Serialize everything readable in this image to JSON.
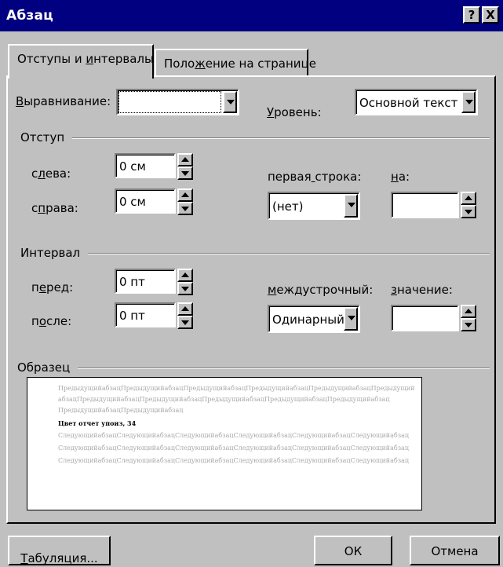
{
  "window": {
    "title": "Абзац",
    "help_button": "?",
    "close_button": "X"
  },
  "tabs": [
    {
      "label_pre": "Отступы и ",
      "label_u": "и",
      "label_post": "нтервалы",
      "active": true
    },
    {
      "label_pre": "Поло",
      "label_u": "ж",
      "label_post": "ение на странице",
      "active": false
    }
  ],
  "alignment": {
    "label_u": "В",
    "label_rest": "ыравнивание:",
    "value": ""
  },
  "level": {
    "label_u": "У",
    "label_rest": "ровень:",
    "value": "Основной текст"
  },
  "indent": {
    "group_title": "Отступ",
    "left": {
      "label_pre": "с",
      "label_u": "л",
      "label_post": "ева:",
      "value": "0 см"
    },
    "right": {
      "label_pre": "с",
      "label_u": "п",
      "label_post": "рава:",
      "value": "0 см"
    },
    "first_line": {
      "label_pre": "первая",
      "label_u": " ",
      "label_post": "строка:",
      "value": "(нет)"
    },
    "by": {
      "label_u": "н",
      "label_post": "а:",
      "value": ""
    }
  },
  "spacing": {
    "group_title": "Интервал",
    "before": {
      "label_pre": "п",
      "label_u": "е",
      "label_post": "ред:",
      "value": "0 пт"
    },
    "after": {
      "label_pre": "п",
      "label_u": "о",
      "label_post": "сле:",
      "value": "0 пт"
    },
    "line": {
      "label_u": "м",
      "label_post": "еждустрочный:",
      "value": "Одинарный"
    },
    "at": {
      "label_u": "з",
      "label_post": "начение:",
      "value": ""
    }
  },
  "preview": {
    "group_title": "Образец",
    "lines": [
      {
        "text": "ПредыдущийабзацПредыдущийабзацПредыдущийабзацПредыдущийабзацПредыдущийабзацПредыдущий",
        "style": "prev"
      },
      {
        "text": "абзацПредыдущийабзацПредыдущийабзацПредыдущийабзацПредыдущийабзацПредыдущийабзац",
        "style": "prev"
      },
      {
        "text": "ПредыдущийабзацПредыдущийабзац",
        "style": "prev"
      },
      {
        "text": "Цвет отчет упоиз, 34",
        "style": "current"
      },
      {
        "text": "СледующийабзацСледующийабзацСледующийабзацСледующийабзацСледующийабзацСледующийабзац",
        "style": "next"
      },
      {
        "text": "СледующийабзацСледующийабзацСледующийабзацСледующийабзацСледующийабзацСледующийабзац",
        "style": "next"
      },
      {
        "text": "СледующийабзацСледующийабзацСледующийабзацСледующийабзацСледующийабзацСледующийабзац",
        "style": "next"
      }
    ]
  },
  "buttons": {
    "tabs": {
      "label_u": "Т",
      "label_rest": "абуляция..."
    },
    "ok": "ОК",
    "cancel": "Отмена"
  },
  "colors": {
    "titlebar": "#000080",
    "face": "#c0c0c0",
    "preview_gray": "#a8a8a8"
  }
}
